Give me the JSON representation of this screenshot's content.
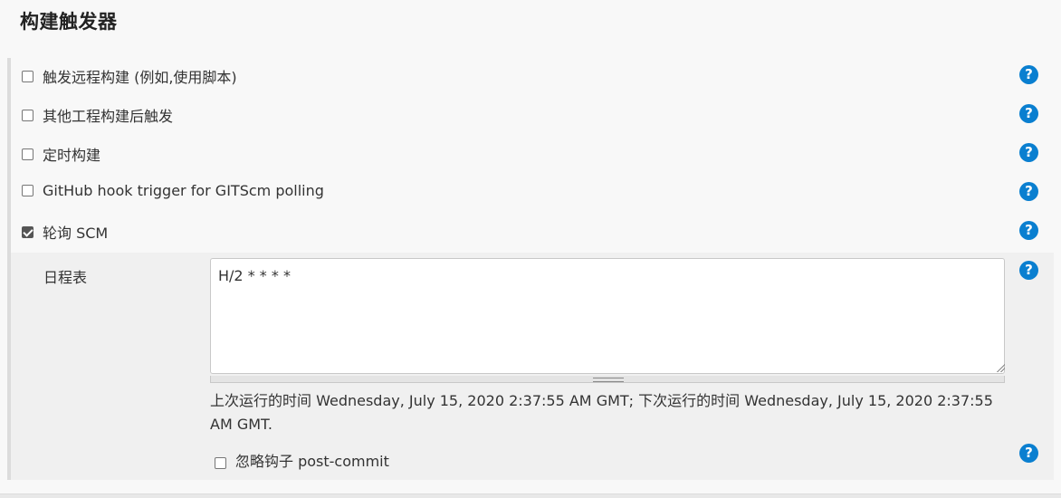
{
  "section": {
    "title": "构建触发器"
  },
  "options": [
    {
      "label": "触发远程构建 (例如,使用脚本)",
      "checked": false
    },
    {
      "label": "其他工程构建后触发",
      "checked": false
    },
    {
      "label": "定时构建",
      "checked": false
    },
    {
      "label": "GitHub hook trigger for GITScm polling",
      "checked": false
    },
    {
      "label": "轮询 SCM",
      "checked": true
    }
  ],
  "scm": {
    "schedule_label": "日程表",
    "schedule_value": "H/2 * * * *",
    "run_info": "上次运行的时间 Wednesday, July 15, 2020 2:37:55 AM GMT; 下次运行的时间 Wednesday, July 15, 2020 2:37:55 AM GMT.",
    "ignore_label": "忽略钩子 post-commit",
    "ignore_checked": false
  },
  "help": {
    "glyph": "?",
    "color": "#0a7fd0"
  }
}
